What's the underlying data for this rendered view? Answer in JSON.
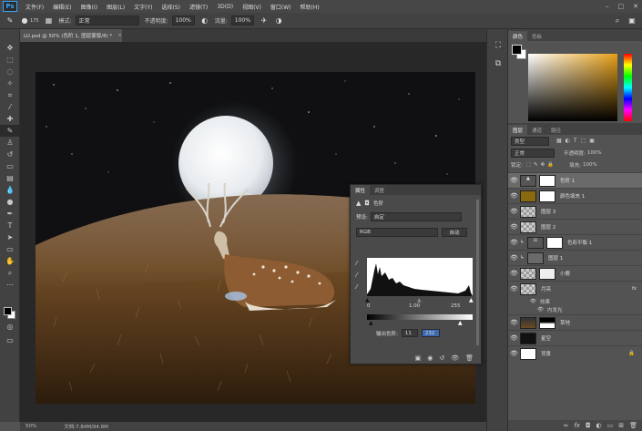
{
  "app": {
    "logo": "Ps"
  },
  "menu": [
    "文件(F)",
    "编辑(E)",
    "图像(I)",
    "图层(L)",
    "文字(Y)",
    "选择(S)",
    "滤镜(T)",
    "3D(D)",
    "视图(V)",
    "窗口(W)",
    "帮助(H)"
  ],
  "options": {
    "mode_label": "模式:",
    "mode_value": "正常",
    "opacity_label": "不透明度:",
    "opacity_value": "100%",
    "flow_label": "流量:",
    "flow_value": "100%",
    "brush_size": "175"
  },
  "document": {
    "tab_title": "LU.psd @ 50% (色阶 1, 图层蒙版/8) *",
    "close": "×"
  },
  "status": {
    "zoom": "50%",
    "doc_size": "文档:7.84M/94.8M"
  },
  "color_panel": {
    "tabs": [
      "颜色",
      "色板"
    ]
  },
  "layers_panel": {
    "tabs": [
      "图层",
      "通道",
      "路径"
    ],
    "filter_label": "类型",
    "blend_mode": "正常",
    "opacity_label": "不透明度:",
    "opacity_value": "100%",
    "lock_label": "锁定:",
    "fill_label": "填充:",
    "fill_value": "100%",
    "layers": [
      {
        "name": "色阶 1",
        "selected": true
      },
      {
        "name": "颜色填充 1",
        "selected": false
      },
      {
        "name": "图层 3",
        "selected": false
      },
      {
        "name": "图层 2",
        "selected": false
      },
      {
        "name": "色彩平衡 1",
        "selected": false
      },
      {
        "name": "图层 1",
        "selected": false
      },
      {
        "name": "小鹿",
        "selected": false
      },
      {
        "name": "月亮",
        "selected": false
      },
      {
        "name": "草地",
        "selected": false
      },
      {
        "name": "星空",
        "selected": false
      },
      {
        "name": "背景",
        "selected": false
      }
    ],
    "effects_label": "效果",
    "effect_name": "内发光",
    "fx": "fx"
  },
  "properties": {
    "tabs": [
      "属性",
      "调整"
    ],
    "title": "色阶",
    "preset_label": "预设:",
    "preset_value": "自定",
    "channel": "RGB",
    "auto_button": "自动",
    "input_black": "0",
    "input_gamma": "1.00",
    "input_white": "255",
    "output_label": "输出色阶:",
    "output_black": "11",
    "output_white": "232"
  },
  "colors": {
    "accent": "#31a8ff",
    "background": "#535353",
    "panel": "#424242"
  }
}
